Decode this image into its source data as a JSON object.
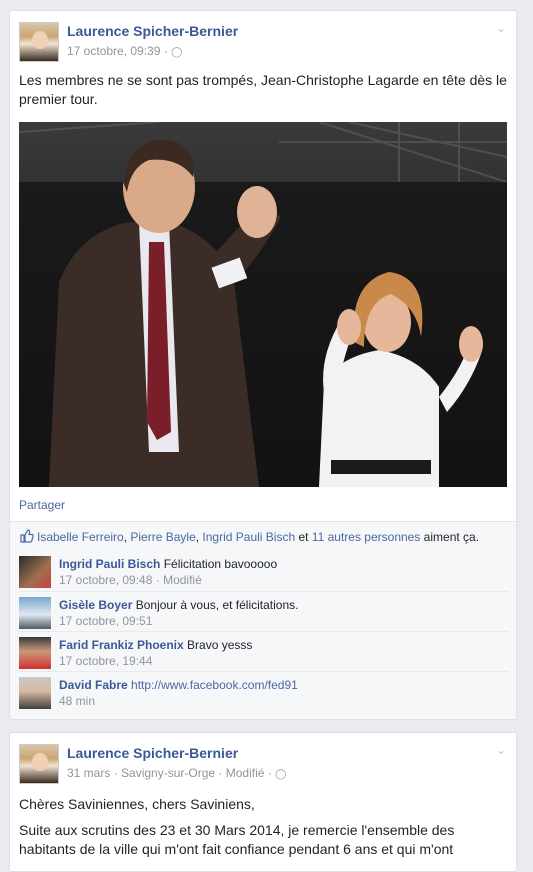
{
  "post1": {
    "author": "Laurence Spicher-Bernier",
    "time": "17 octobre, 09:39",
    "text": "Les membres ne se sont pas trompés, Jean-Christophe Lagarde en tête dès le premier tour.",
    "share_label": "Partager",
    "likes": {
      "names": [
        "Isabelle Ferreiro",
        "Pierre Bayle",
        "Ingrid Pauli Bisch"
      ],
      "sep1": ", ",
      "sep2": ", ",
      "conj": " et ",
      "others": "11 autres personnes",
      "suffix": " aiment ça."
    },
    "comments": [
      {
        "name": "Ingrid Pauli Bisch",
        "text": "Félicitation bavooooo",
        "time": "17 octobre, 09:48",
        "edited": "Modifié"
      },
      {
        "name": "Gisèle Boyer",
        "text": "Bonjour à vous, et félicitations.",
        "time": "17 octobre, 09:51"
      },
      {
        "name": "Farid Frankiz Phoenix",
        "text": "Bravo yesss",
        "time": "17 octobre, 19:44"
      },
      {
        "name": "David Fabre",
        "text": "http://www.facebook.com/fed91",
        "time": "48 min"
      }
    ]
  },
  "post2": {
    "author": "Laurence Spicher-Bernier",
    "time": "31 mars",
    "location": "Savigny-sur-Orge",
    "edited": "Modifié",
    "text1": "Chères Saviniennes, chers Saviniens,",
    "text2": "Suite aux scrutins des 23 et 30 Mars 2014, je remercie l'ensemble des habitants de la ville qui m'ont fait confiance pendant 6 ans et qui m'ont"
  },
  "separators": {
    "dot": " · "
  },
  "colors": {
    "link": "#3b5998",
    "muted": "#90949c",
    "background": "#e9ebee"
  }
}
